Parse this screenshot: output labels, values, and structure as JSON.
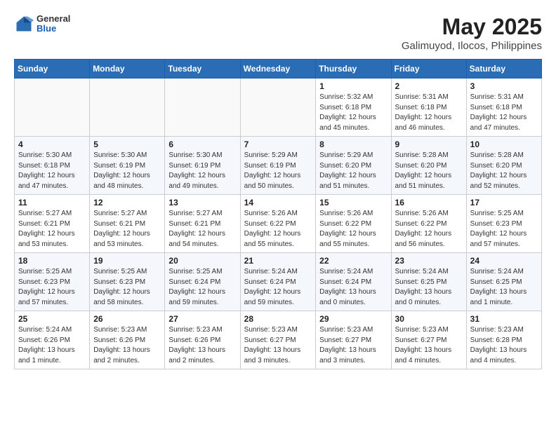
{
  "header": {
    "logo": {
      "general": "General",
      "blue": "Blue"
    },
    "title": "May 2025",
    "subtitle": "Galimuyod, Ilocos, Philippines"
  },
  "weekdays": [
    "Sunday",
    "Monday",
    "Tuesday",
    "Wednesday",
    "Thursday",
    "Friday",
    "Saturday"
  ],
  "weeks": [
    [
      {
        "day": "",
        "info": ""
      },
      {
        "day": "",
        "info": ""
      },
      {
        "day": "",
        "info": ""
      },
      {
        "day": "",
        "info": ""
      },
      {
        "day": "1",
        "info": "Sunrise: 5:32 AM\nSunset: 6:18 PM\nDaylight: 12 hours\nand 45 minutes."
      },
      {
        "day": "2",
        "info": "Sunrise: 5:31 AM\nSunset: 6:18 PM\nDaylight: 12 hours\nand 46 minutes."
      },
      {
        "day": "3",
        "info": "Sunrise: 5:31 AM\nSunset: 6:18 PM\nDaylight: 12 hours\nand 47 minutes."
      }
    ],
    [
      {
        "day": "4",
        "info": "Sunrise: 5:30 AM\nSunset: 6:18 PM\nDaylight: 12 hours\nand 47 minutes."
      },
      {
        "day": "5",
        "info": "Sunrise: 5:30 AM\nSunset: 6:19 PM\nDaylight: 12 hours\nand 48 minutes."
      },
      {
        "day": "6",
        "info": "Sunrise: 5:30 AM\nSunset: 6:19 PM\nDaylight: 12 hours\nand 49 minutes."
      },
      {
        "day": "7",
        "info": "Sunrise: 5:29 AM\nSunset: 6:19 PM\nDaylight: 12 hours\nand 50 minutes."
      },
      {
        "day": "8",
        "info": "Sunrise: 5:29 AM\nSunset: 6:20 PM\nDaylight: 12 hours\nand 51 minutes."
      },
      {
        "day": "9",
        "info": "Sunrise: 5:28 AM\nSunset: 6:20 PM\nDaylight: 12 hours\nand 51 minutes."
      },
      {
        "day": "10",
        "info": "Sunrise: 5:28 AM\nSunset: 6:20 PM\nDaylight: 12 hours\nand 52 minutes."
      }
    ],
    [
      {
        "day": "11",
        "info": "Sunrise: 5:27 AM\nSunset: 6:21 PM\nDaylight: 12 hours\nand 53 minutes."
      },
      {
        "day": "12",
        "info": "Sunrise: 5:27 AM\nSunset: 6:21 PM\nDaylight: 12 hours\nand 53 minutes."
      },
      {
        "day": "13",
        "info": "Sunrise: 5:27 AM\nSunset: 6:21 PM\nDaylight: 12 hours\nand 54 minutes."
      },
      {
        "day": "14",
        "info": "Sunrise: 5:26 AM\nSunset: 6:22 PM\nDaylight: 12 hours\nand 55 minutes."
      },
      {
        "day": "15",
        "info": "Sunrise: 5:26 AM\nSunset: 6:22 PM\nDaylight: 12 hours\nand 55 minutes."
      },
      {
        "day": "16",
        "info": "Sunrise: 5:26 AM\nSunset: 6:22 PM\nDaylight: 12 hours\nand 56 minutes."
      },
      {
        "day": "17",
        "info": "Sunrise: 5:25 AM\nSunset: 6:23 PM\nDaylight: 12 hours\nand 57 minutes."
      }
    ],
    [
      {
        "day": "18",
        "info": "Sunrise: 5:25 AM\nSunset: 6:23 PM\nDaylight: 12 hours\nand 57 minutes."
      },
      {
        "day": "19",
        "info": "Sunrise: 5:25 AM\nSunset: 6:23 PM\nDaylight: 12 hours\nand 58 minutes."
      },
      {
        "day": "20",
        "info": "Sunrise: 5:25 AM\nSunset: 6:24 PM\nDaylight: 12 hours\nand 59 minutes."
      },
      {
        "day": "21",
        "info": "Sunrise: 5:24 AM\nSunset: 6:24 PM\nDaylight: 12 hours\nand 59 minutes."
      },
      {
        "day": "22",
        "info": "Sunrise: 5:24 AM\nSunset: 6:24 PM\nDaylight: 13 hours\nand 0 minutes."
      },
      {
        "day": "23",
        "info": "Sunrise: 5:24 AM\nSunset: 6:25 PM\nDaylight: 13 hours\nand 0 minutes."
      },
      {
        "day": "24",
        "info": "Sunrise: 5:24 AM\nSunset: 6:25 PM\nDaylight: 13 hours\nand 1 minute."
      }
    ],
    [
      {
        "day": "25",
        "info": "Sunrise: 5:24 AM\nSunset: 6:26 PM\nDaylight: 13 hours\nand 1 minute."
      },
      {
        "day": "26",
        "info": "Sunrise: 5:23 AM\nSunset: 6:26 PM\nDaylight: 13 hours\nand 2 minutes."
      },
      {
        "day": "27",
        "info": "Sunrise: 5:23 AM\nSunset: 6:26 PM\nDaylight: 13 hours\nand 2 minutes."
      },
      {
        "day": "28",
        "info": "Sunrise: 5:23 AM\nSunset: 6:27 PM\nDaylight: 13 hours\nand 3 minutes."
      },
      {
        "day": "29",
        "info": "Sunrise: 5:23 AM\nSunset: 6:27 PM\nDaylight: 13 hours\nand 3 minutes."
      },
      {
        "day": "30",
        "info": "Sunrise: 5:23 AM\nSunset: 6:27 PM\nDaylight: 13 hours\nand 4 minutes."
      },
      {
        "day": "31",
        "info": "Sunrise: 5:23 AM\nSunset: 6:28 PM\nDaylight: 13 hours\nand 4 minutes."
      }
    ]
  ]
}
